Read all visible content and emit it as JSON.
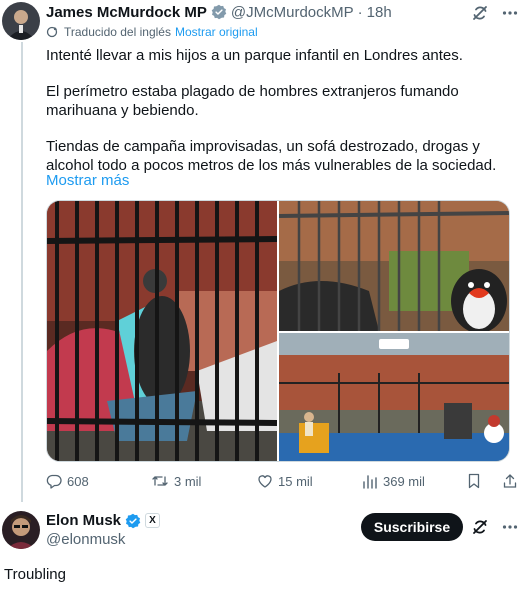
{
  "tweet": {
    "author_name": "James McMurdock MP",
    "author_handle": "@JMcMurdockMP",
    "separator": "·",
    "time": "18h",
    "translated_label": "Traducido del inglés",
    "show_original": "Mostrar original",
    "paragraphs": [
      "Intenté llevar a mis hijos a un parque infantil en Londres antes.",
      "El perímetro estaba plagado de hombres extranjeros fumando marihuana y bebiendo.",
      "Tiendas de campaña improvisadas, un sofá destrozado, drogas y alcohol todo a pocos metros de los más vulnerables de la sociedad."
    ],
    "show_more": "Mostrar más",
    "metrics": {
      "replies": "608",
      "reposts": "3 mil",
      "likes": "15 mil",
      "views": "369 mil"
    }
  },
  "reply": {
    "author_name": "Elon Musk",
    "author_handle": "@elonmusk",
    "badge": "X",
    "subscribe_label": "Suscribirse",
    "text": "Troubling"
  },
  "colors": {
    "accent": "#1d9bf0",
    "text": "#0f1419",
    "secondary": "#536471",
    "border": "#cfd9de"
  }
}
